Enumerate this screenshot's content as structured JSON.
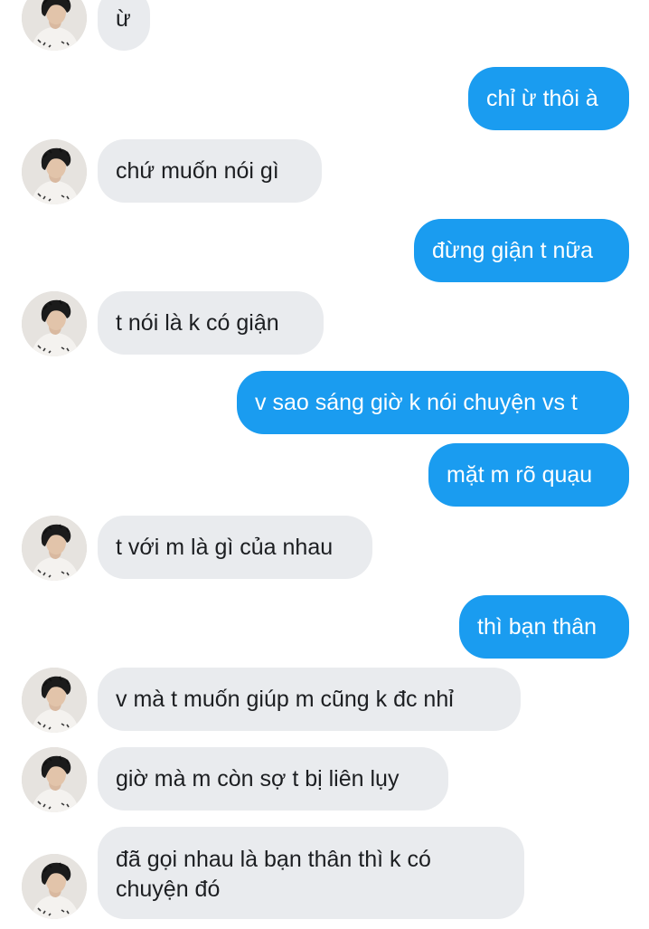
{
  "conversation": {
    "messages": [
      {
        "side": "in",
        "text": "ừ"
      },
      {
        "side": "out",
        "text": "chỉ ừ thôi à"
      },
      {
        "side": "in",
        "text": "chứ muốn nói gì"
      },
      {
        "side": "out",
        "text": "đừng giận t nữa"
      },
      {
        "side": "in",
        "text": "t nói là k có giận"
      },
      {
        "side": "out",
        "text": "v sao sáng giờ k nói chuyện vs t"
      },
      {
        "side": "out",
        "text": "mặt m rõ quạu"
      },
      {
        "side": "in",
        "text": "t với m là gì của nhau"
      },
      {
        "side": "out",
        "text": "thì bạn thân"
      },
      {
        "side": "in",
        "text": "v mà t muốn giúp m cũng k đc nhỉ"
      },
      {
        "side": "in",
        "text": "giờ mà m còn sợ t bị liên lụy"
      },
      {
        "side": "in",
        "text": "đã gọi nhau là bạn thân thì k có chuyện đó"
      }
    ]
  },
  "colors": {
    "outgoing_bubble": "#1a9cf0",
    "incoming_bubble": "#e9ebee"
  },
  "icons": {
    "contact_avatar": "contact-avatar"
  }
}
